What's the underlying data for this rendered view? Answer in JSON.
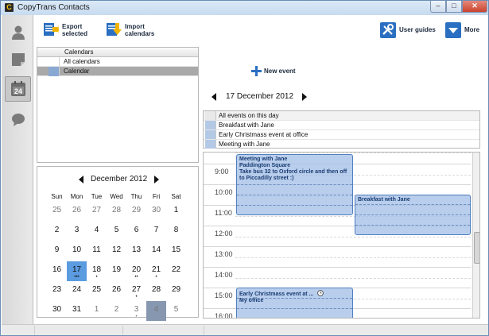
{
  "window": {
    "title": "CopyTrans Contacts",
    "app_icon_letter": "C",
    "min_label": "–",
    "max_label": "□",
    "close_label": "✕"
  },
  "sidebar": {
    "items": [
      {
        "name": "contacts",
        "icon": "person-icon"
      },
      {
        "name": "notes",
        "icon": "note-icon"
      },
      {
        "name": "calendars",
        "icon": "calendar-icon",
        "badge": "24",
        "active": true
      },
      {
        "name": "messages",
        "icon": "speech-bubble-icon"
      }
    ]
  },
  "toolbar": {
    "export_label": "Export selected",
    "import_label": "Import calendars",
    "user_guides_label": "User guides",
    "more_label": "More"
  },
  "calendars_panel": {
    "header": "Calendars",
    "rows": [
      "All calendars",
      "Calendar"
    ]
  },
  "new_event_label": "New event",
  "day_nav": {
    "date": "17 December 2012"
  },
  "events_list": {
    "header": "All events on this day",
    "items": [
      "Breakfast with Jane",
      "Early Christmass event at office",
      "Meeting with Jane"
    ]
  },
  "day_view": {
    "hours": [
      "9:00",
      "10:00",
      "11:00",
      "12:00",
      "13:00",
      "14:00",
      "15:00",
      "16:00"
    ],
    "events": {
      "meeting": {
        "title": "Meeting with Jane",
        "location": "Paddington Square",
        "note": "Take bus 32 to Oxford circle and then off to Piccadilly street :)"
      },
      "breakfast": {
        "title": "Breakfast with Jane"
      },
      "christmas": {
        "title": "Early Christmass event at ...",
        "location": "My office"
      }
    }
  },
  "mini_calendar": {
    "title": "December 2012",
    "dow": [
      "Sun",
      "Mon",
      "Tue",
      "Wed",
      "Thu",
      "Fri",
      "Sat"
    ],
    "weeks": [
      [
        "25",
        "26",
        "27",
        "28",
        "29",
        "30",
        "1"
      ],
      [
        "2",
        "3",
        "4",
        "5",
        "6",
        "7",
        "8"
      ],
      [
        "9",
        "10",
        "11",
        "12",
        "13",
        "14",
        "15"
      ],
      [
        "16",
        "17",
        "18",
        "19",
        "20",
        "21",
        "22"
      ],
      [
        "23",
        "24",
        "25",
        "26",
        "27",
        "28",
        "29"
      ],
      [
        "30",
        "31",
        "1",
        "2",
        "3",
        "4",
        "5"
      ]
    ],
    "today": "17",
    "accent": "#5b9be0"
  }
}
